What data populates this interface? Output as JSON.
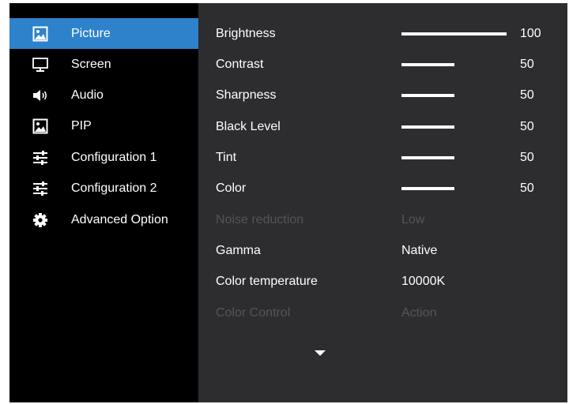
{
  "sidebar": {
    "items": [
      {
        "label": "Picture",
        "icon": "picture-icon",
        "active": true
      },
      {
        "label": "Screen",
        "icon": "monitor-icon"
      },
      {
        "label": "Audio",
        "icon": "speaker-icon"
      },
      {
        "label": "PIP",
        "icon": "picture-icon"
      },
      {
        "label": "Configuration 1",
        "icon": "sliders-icon"
      },
      {
        "label": "Configuration 2",
        "icon": "sliders-icon"
      },
      {
        "label": "Advanced Option",
        "icon": "gear-icon"
      }
    ]
  },
  "settings": {
    "brightness": {
      "label": "Brightness",
      "value": "100",
      "level": 100
    },
    "contrast": {
      "label": "Contrast",
      "value": "50",
      "level": 50
    },
    "sharpness": {
      "label": "Sharpness",
      "value": "50",
      "level": 50
    },
    "black_level": {
      "label": "Black Level",
      "value": "50",
      "level": 50
    },
    "tint": {
      "label": "Tint",
      "value": "50",
      "level": 50
    },
    "color": {
      "label": "Color",
      "value": "50",
      "level": 50
    },
    "noise_reduction": {
      "label": "Noise reduction",
      "value": "Low",
      "disabled": true
    },
    "gamma": {
      "label": "Gamma",
      "value": "Native"
    },
    "color_temperature": {
      "label": "Color temperature",
      "value": "10000K"
    },
    "color_control": {
      "label": "Color Control",
      "value": "Action",
      "disabled": true
    }
  },
  "colors": {
    "sidebar_bg": "#000000",
    "main_bg": "#2d2d2f",
    "active_highlight": "#2e82cc",
    "text": "#ffffff",
    "disabled_text": "#555558"
  },
  "more_indicator": "chevron-down-icon"
}
